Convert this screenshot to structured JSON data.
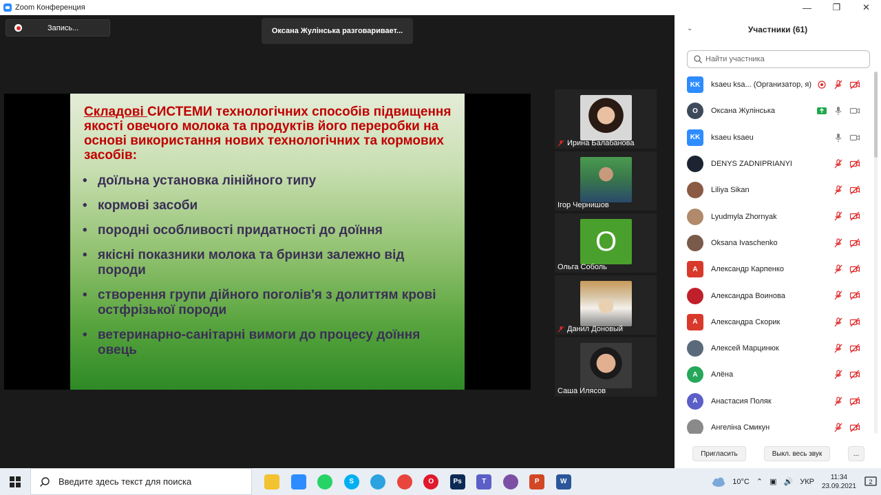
{
  "window": {
    "title": "Zoom Конференция",
    "minimize": "—",
    "restore": "❐",
    "close": "✕"
  },
  "meeting": {
    "record_label": "Запись...",
    "talking_label": "Оксана Жулінська разговаривает...",
    "slide": {
      "title_underlined": "Складові ",
      "title_rest": "СИСТЕМИ технологічних способів підвищення якості овечого молока та продуктів його переробки на основі використання нових технологічних та кормових засобів:",
      "bullets": [
        "доїльна установка лінійного типу",
        "кормові засоби",
        "породні особливості придатності до доїння",
        "якісні показники молока та бринзи залежно від породи",
        "створення групи дійного поголів'я з долиттям крові остфрізької породи",
        "ветеринарно-санітарні вимоги до процесу доїння овець"
      ]
    },
    "thumbnails": [
      {
        "name": "Ирина Балабанова",
        "muted": true
      },
      {
        "name": "Ігор Чернишов",
        "muted": false
      },
      {
        "name": "Ольга Соболь",
        "muted": false,
        "initial": "О"
      },
      {
        "name": "Данил Доновый",
        "muted": true
      },
      {
        "name": "Саша Илясов",
        "muted": false
      }
    ]
  },
  "panel": {
    "title": "Участники (61)",
    "search_placeholder": "Найти участника",
    "participants": [
      {
        "initials": "KK",
        "color": "#2d8cff",
        "name": "ksaeu ksa... (Организатор, я)",
        "mic": "muted",
        "video": "off",
        "rec": true
      },
      {
        "initials": "О",
        "color": "#3d4a5c",
        "round": true,
        "name": "Оксана Жулінська",
        "mic": "on",
        "video": "on-gray",
        "share": true
      },
      {
        "initials": "KK",
        "color": "#2d8cff",
        "name": "ksaeu ksaeu",
        "mic": "on",
        "video": "on-gray"
      },
      {
        "initials": "",
        "color": "#1b2430",
        "round": true,
        "name": "DENYS ZADNIPRIANYI",
        "mic": "muted",
        "video": "off"
      },
      {
        "initials": "",
        "color": "#8a5a44",
        "round": true,
        "name": "Liliya Sikan",
        "mic": "muted",
        "video": "off"
      },
      {
        "initials": "",
        "color": "#b08a6a",
        "round": true,
        "name": "Lyudmyla Zhornyak",
        "mic": "muted",
        "video": "off"
      },
      {
        "initials": "",
        "color": "#7a5a4a",
        "round": true,
        "name": "Oksana Ivaschenko",
        "mic": "muted",
        "video": "off"
      },
      {
        "initials": "А",
        "color": "#d9392b",
        "name": "Александр Карпенко",
        "mic": "muted",
        "video": "off"
      },
      {
        "initials": "",
        "color": "#c0202a",
        "round": true,
        "name": "Александра Воинова",
        "mic": "muted",
        "video": "off"
      },
      {
        "initials": "А",
        "color": "#d9392b",
        "name": "Александра Скорик",
        "mic": "muted",
        "video": "off"
      },
      {
        "initials": "",
        "color": "#5a6a7a",
        "round": true,
        "name": "Алексей Марцинюк",
        "mic": "muted",
        "video": "off"
      },
      {
        "initials": "А",
        "color": "#26a85a",
        "round": true,
        "name": "Алёна",
        "mic": "muted",
        "video": "off"
      },
      {
        "initials": "А",
        "color": "#5b5fc7",
        "round": true,
        "name": "Анастасия Поляк",
        "mic": "muted",
        "video": "off"
      },
      {
        "initials": "",
        "color": "#8a8a8a",
        "round": true,
        "name": "Ангеліна Смикун",
        "mic": "muted",
        "video": "off"
      }
    ],
    "invite_label": "Пригласить",
    "mute_all_label": "Выкл. весь звук",
    "more_label": "..."
  },
  "taskbar": {
    "search_placeholder": "Введите здесь текст для поиска",
    "apps": [
      {
        "name": "file-explorer",
        "color": "#f2c230",
        "glyph": ""
      },
      {
        "name": "zoom",
        "color": "#2d8cff",
        "glyph": ""
      },
      {
        "name": "whatsapp",
        "color": "#25d366",
        "glyph": "",
        "circle": true
      },
      {
        "name": "skype",
        "color": "#00aff0",
        "glyph": "S",
        "circle": true
      },
      {
        "name": "telegram",
        "color": "#2aa3df",
        "glyph": "",
        "circle": true
      },
      {
        "name": "chrome",
        "color": "#e8453c",
        "glyph": "",
        "circle": true
      },
      {
        "name": "opera",
        "color": "#e0192c",
        "glyph": "O",
        "circle": true
      },
      {
        "name": "photoshop",
        "color": "#0c2a55",
        "glyph": "Ps"
      },
      {
        "name": "teams",
        "color": "#5b5fc7",
        "glyph": "T"
      },
      {
        "name": "viber",
        "color": "#7b4fa3",
        "glyph": "",
        "circle": true
      },
      {
        "name": "powerpoint",
        "color": "#d24726",
        "glyph": "P"
      },
      {
        "name": "word",
        "color": "#2b579a",
        "glyph": "W"
      }
    ],
    "temperature": "10°C",
    "language": "УКР",
    "time": "11:34",
    "date": "23.09.2021",
    "notifications": "2"
  }
}
